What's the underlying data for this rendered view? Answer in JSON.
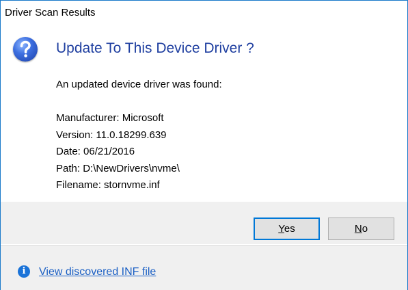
{
  "window": {
    "title": "Driver Scan Results"
  },
  "dialog": {
    "heading": "Update To This Device Driver ?",
    "intro": "An updated device driver was found:",
    "details": [
      {
        "text": "Manufacturer: Microsoft"
      },
      {
        "text": "Version: 11.0.18299.639"
      },
      {
        "text": "Date: 06/21/2016"
      },
      {
        "text": "Path: D:\\NewDrivers\\nvme\\"
      },
      {
        "text": "Filename: stornvme.inf"
      }
    ],
    "icon": "question-icon"
  },
  "buttons": {
    "yes": {
      "access_key": "Y",
      "rest": "es"
    },
    "no": {
      "access_key": "N",
      "rest": "o"
    }
  },
  "footer": {
    "icon": "info-icon",
    "link_text": "View discovered INF file"
  },
  "colors": {
    "accent": "#0078d7",
    "heading": "#1f3fa0",
    "link": "#1a5fc4",
    "window_border": "#1979ca"
  }
}
